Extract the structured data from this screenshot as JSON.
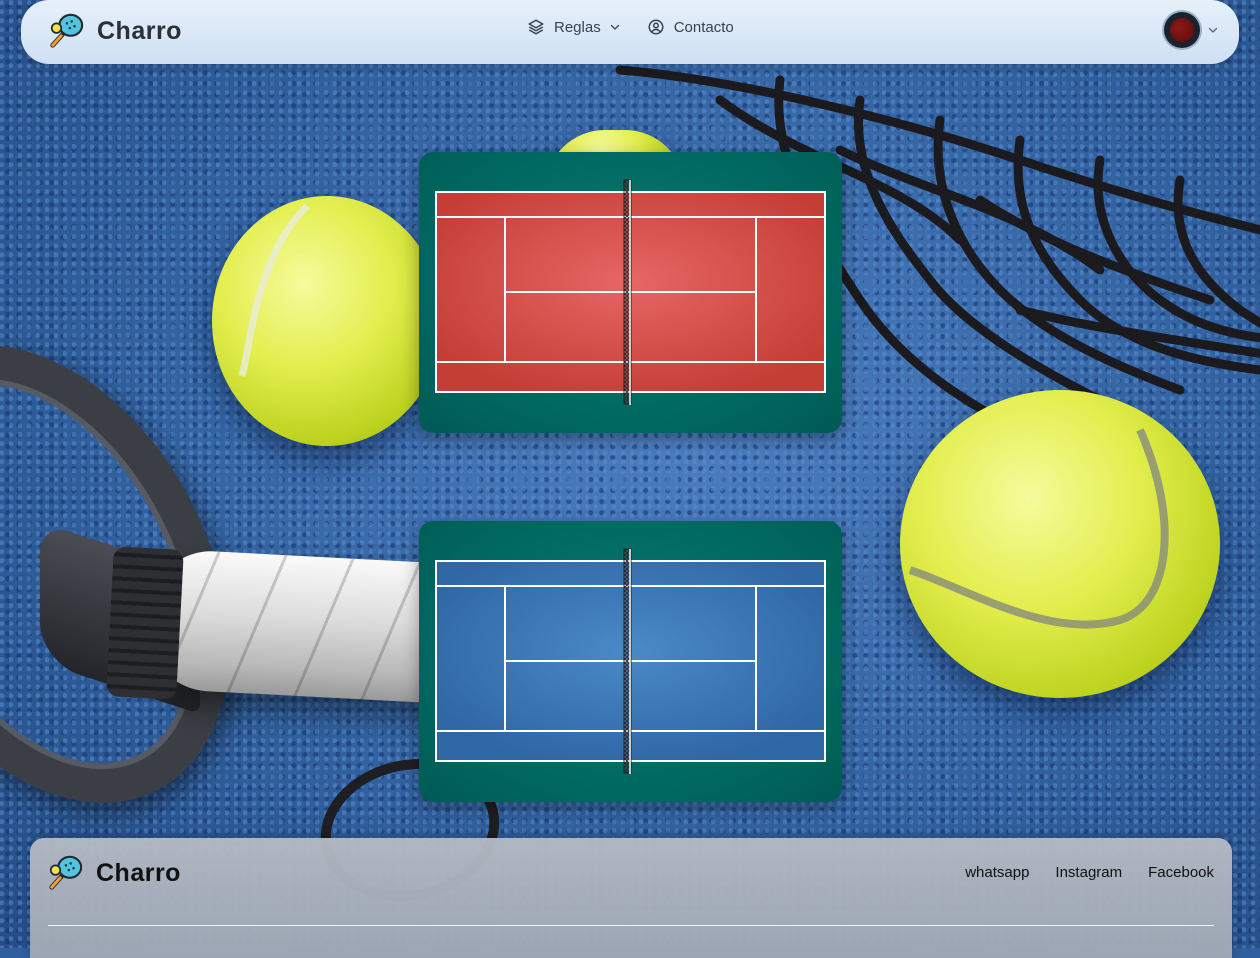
{
  "header": {
    "brand_name": "Charro",
    "logo_icon": "padel-racket-ball-icon",
    "nav": [
      {
        "label": "Reglas",
        "icon": "layers-icon",
        "has_dropdown": true
      },
      {
        "label": "Contacto",
        "icon": "user-circle-icon",
        "has_dropdown": false
      }
    ],
    "user_menu": {
      "icon": "avatar",
      "has_dropdown": true
    }
  },
  "courts": [
    {
      "name": "clay-court",
      "surface_color": "#d4504a",
      "border_color": "#006a62"
    },
    {
      "name": "hard-court",
      "surface_color": "#3a73b0",
      "border_color": "#006a62"
    }
  ],
  "footer": {
    "brand_name": "Charro",
    "links": [
      "whatsapp",
      "Instagram",
      "Facebook"
    ]
  },
  "colors": {
    "header_bg": "#dbe8f8",
    "court_frame": "#006a62",
    "footer_bg": "#aab2be"
  }
}
